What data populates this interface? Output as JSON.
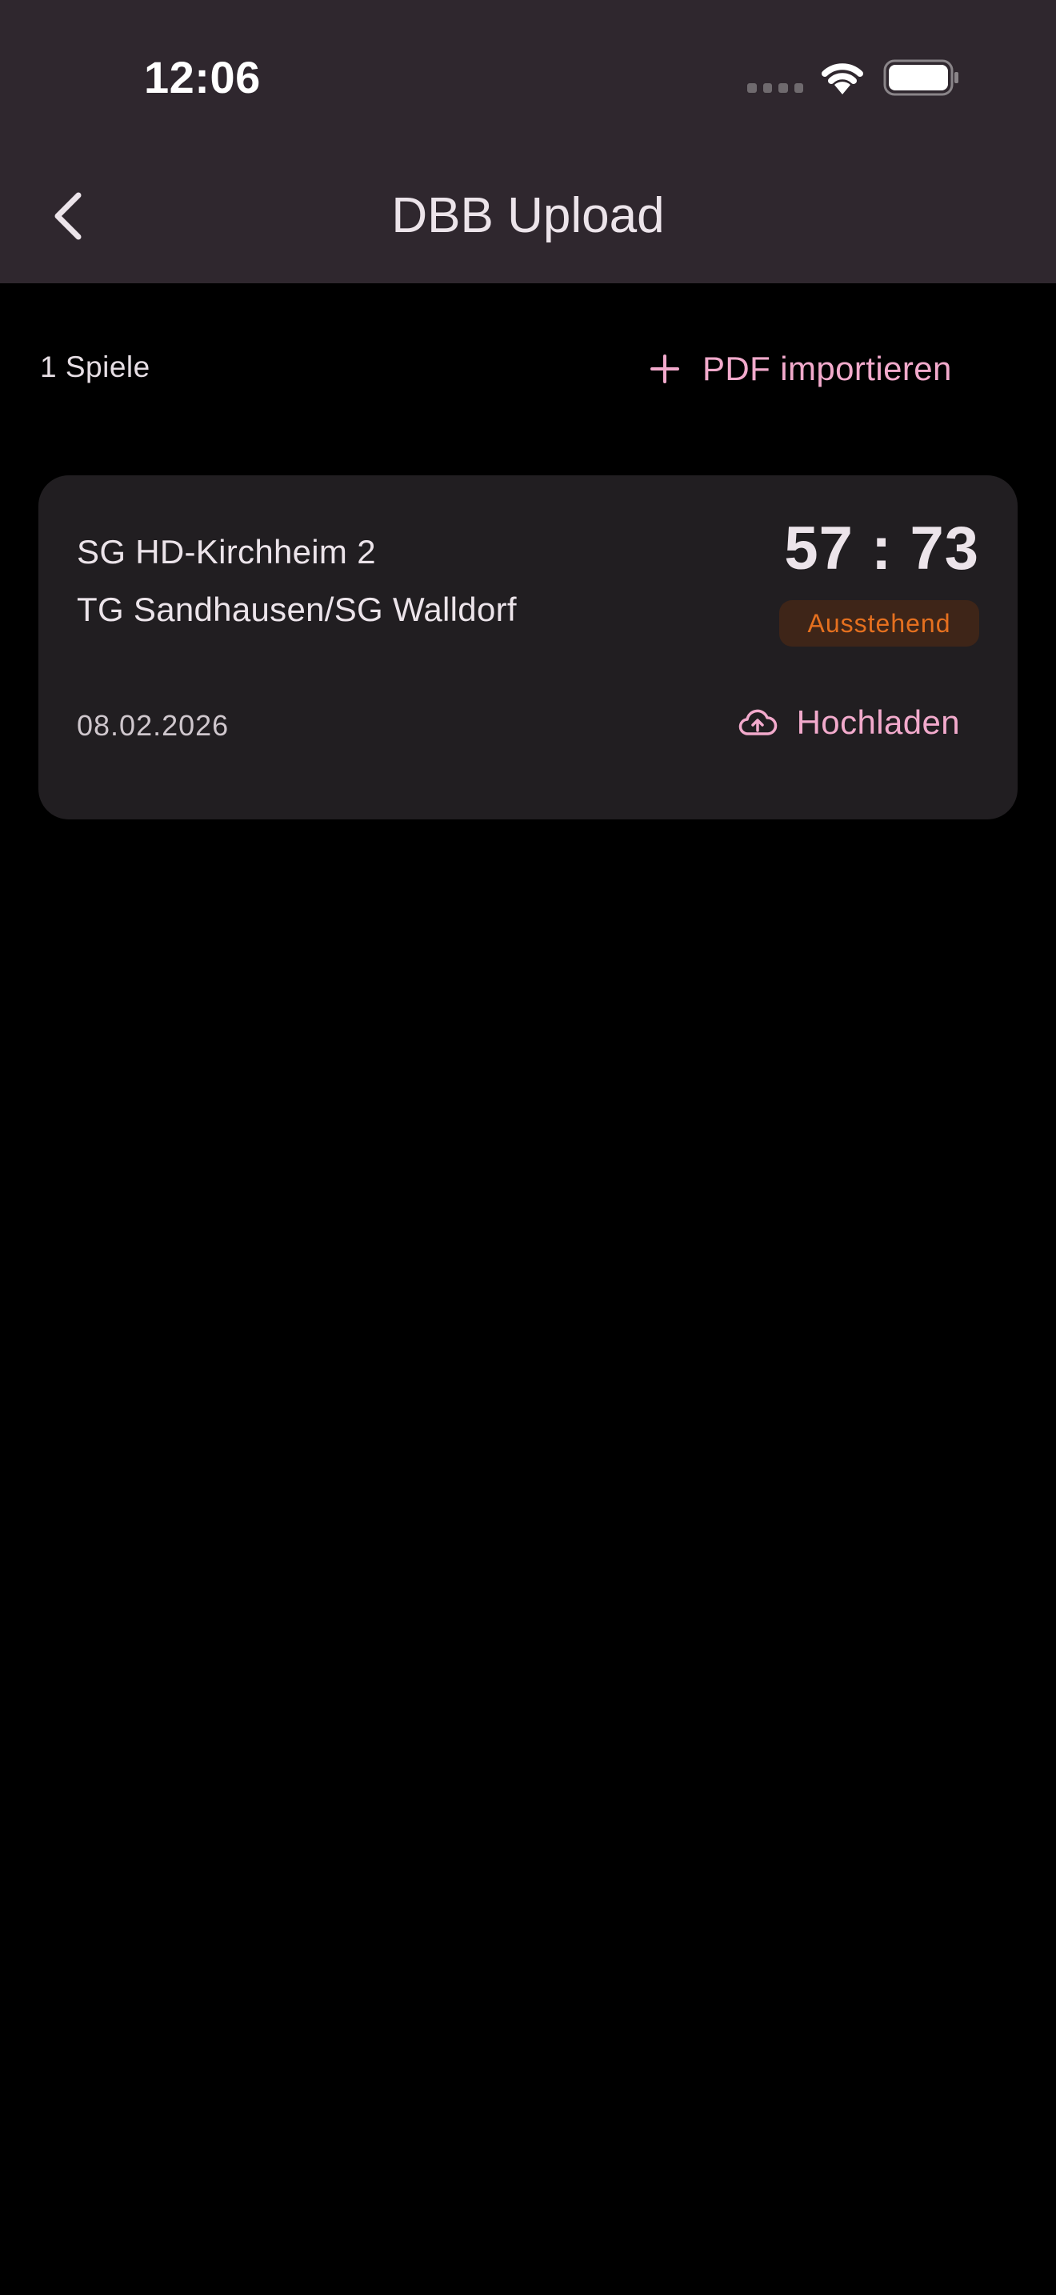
{
  "status_bar": {
    "time": "12:06"
  },
  "nav": {
    "title": "DBB Upload",
    "back_icon": "chevron-left-icon"
  },
  "toolbar": {
    "count": "1 Spiele",
    "import_label": "PDF importieren",
    "import_icon": "plus-icon"
  },
  "games": [
    {
      "home_team": "SG HD-Kirchheim 2",
      "away_team": "TG Sandhausen/SG Walldorf",
      "score": "57 : 73",
      "status": "Ausstehend",
      "date": "08.02.2026",
      "upload_label": "Hochladen",
      "upload_icon": "cloud-upload-icon"
    }
  ],
  "colors": {
    "background": "#000000",
    "header": "#2F272E",
    "card": "#211E21",
    "accent": "#F2AACC",
    "status_text": "#E5701F",
    "status_bg": "#3E2518"
  }
}
